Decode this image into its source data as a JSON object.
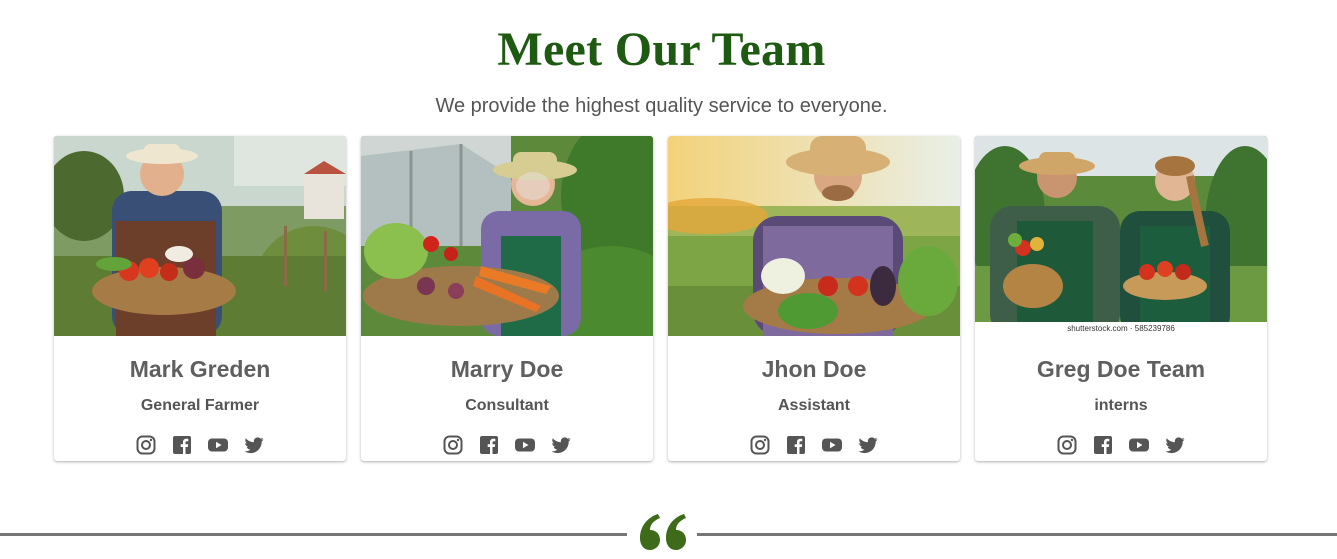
{
  "section": {
    "title": "Meet Our Team",
    "subtitle": "We provide the highest quality service to everyone."
  },
  "team": [
    {
      "name": "Mark Greden",
      "role": "General Farmer",
      "photo": "elderly-farmer-with-vegetable-basket"
    },
    {
      "name": "Marry Doe",
      "role": "Consultant",
      "photo": "elderly-woman-with-vegetable-basket"
    },
    {
      "name": "Jhon Doe",
      "role": "Assistant",
      "photo": "young-farmer-with-vegetable-basket"
    },
    {
      "name": "Greg Doe Team",
      "role": "interns",
      "photo": "two-farmers-with-baskets",
      "watermark": "shutterstock.com · 585239786"
    }
  ],
  "social_icons": [
    "instagram-icon",
    "facebook-icon",
    "youtube-icon",
    "twitter-icon"
  ],
  "colors": {
    "title_green": "#1f5a12",
    "quote_green": "#3d6b1a",
    "text_gray": "#5f5f5f",
    "divider": "#777777"
  }
}
